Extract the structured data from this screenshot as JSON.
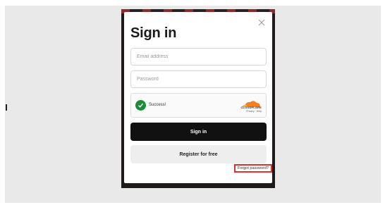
{
  "dialog": {
    "title": "Sign in",
    "close_icon": "close-icon"
  },
  "form": {
    "email_placeholder": "Email address",
    "password_placeholder": "Password"
  },
  "captcha": {
    "status": "Success!",
    "provider": "CLOUDFLARE",
    "links": "Privacy · Help",
    "status_icon": "check-circle-icon",
    "status_color": "#1e8b3a",
    "brand_color": "#f38020"
  },
  "actions": {
    "signin_label": "Sign in",
    "register_label": "Register for free",
    "forgot_label": "Forgot password?"
  },
  "highlight_color": "#e0322b"
}
